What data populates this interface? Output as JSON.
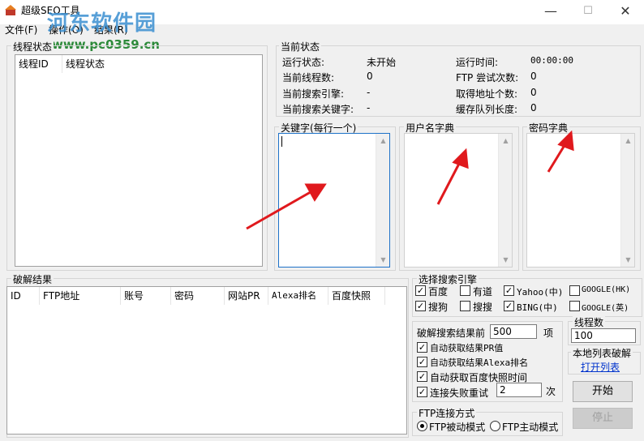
{
  "window": {
    "title": "超级SEO工具",
    "minimize": "—",
    "maximize": "☐",
    "close": "✕"
  },
  "watermark": {
    "name": "河东软件园",
    "url": "www.pc0359.cn"
  },
  "menu": [
    "文件(F)",
    "操作(O)",
    "结果(R)"
  ],
  "thread_status": {
    "group_label": "线程状态",
    "columns": [
      "线程ID",
      "线程状态"
    ]
  },
  "current_status": {
    "group_label": "当前状态",
    "left": [
      {
        "label": "运行状态:",
        "value": "未开始"
      },
      {
        "label": "当前线程数:",
        "value": "0"
      },
      {
        "label": "当前搜索引擎:",
        "value": "-"
      },
      {
        "label": "当前搜索关键字:",
        "value": "-"
      }
    ],
    "right": [
      {
        "label": "运行时间:",
        "value": "00:00:00"
      },
      {
        "label": "FTP 尝试次数:",
        "value": "0"
      },
      {
        "label": "取得地址个数:",
        "value": "0"
      },
      {
        "label": "缓存队列长度:",
        "value": "0"
      }
    ]
  },
  "keywords": {
    "label": "关键字(每行一个)"
  },
  "username_dict": {
    "label": "用户名字典"
  },
  "password_dict": {
    "label": "密码字典"
  },
  "crack_results": {
    "group_label": "破解结果",
    "columns": [
      "ID",
      "FTP地址",
      "账号",
      "密码",
      "网站PR",
      "Alexa排名",
      "百度快照"
    ]
  },
  "engines": {
    "group_label": "选择搜索引擎",
    "items": [
      {
        "label": "百度",
        "checked": true
      },
      {
        "label": "有道",
        "checked": false
      },
      {
        "label": "Yahoo(中)",
        "checked": true
      },
      {
        "label": "GOOGLE(HK)",
        "checked": false
      },
      {
        "label": "搜狗",
        "checked": true
      },
      {
        "label": "搜搜",
        "checked": false
      },
      {
        "label": "BING(中)",
        "checked": true
      },
      {
        "label": "GOOGLE(英)",
        "checked": false
      }
    ]
  },
  "options": {
    "crack_prefix": "破解搜索结果前",
    "crack_count": "500",
    "crack_suffix": "项",
    "auto_pr": "自动获取结果PR值",
    "auto_alexa": "自动获取结果Alexa排名",
    "auto_baidu": "自动获取百度快照时间",
    "retry_label": "连接失败重试",
    "retry_count": "2",
    "retry_suffix": "次"
  },
  "threads": {
    "group_label": "线程数",
    "value": "100"
  },
  "local_list": {
    "label": "本地列表破解",
    "link": "打开列表"
  },
  "ftp_mode": {
    "group_label": "FTP连接方式",
    "passive": "FTP被动模式",
    "active": "FTP主动模式",
    "selected": "passive"
  },
  "buttons": {
    "start": "开始",
    "stop": "停止"
  },
  "colors": {
    "arrow": "#e0191d",
    "link": "#0033cc"
  }
}
